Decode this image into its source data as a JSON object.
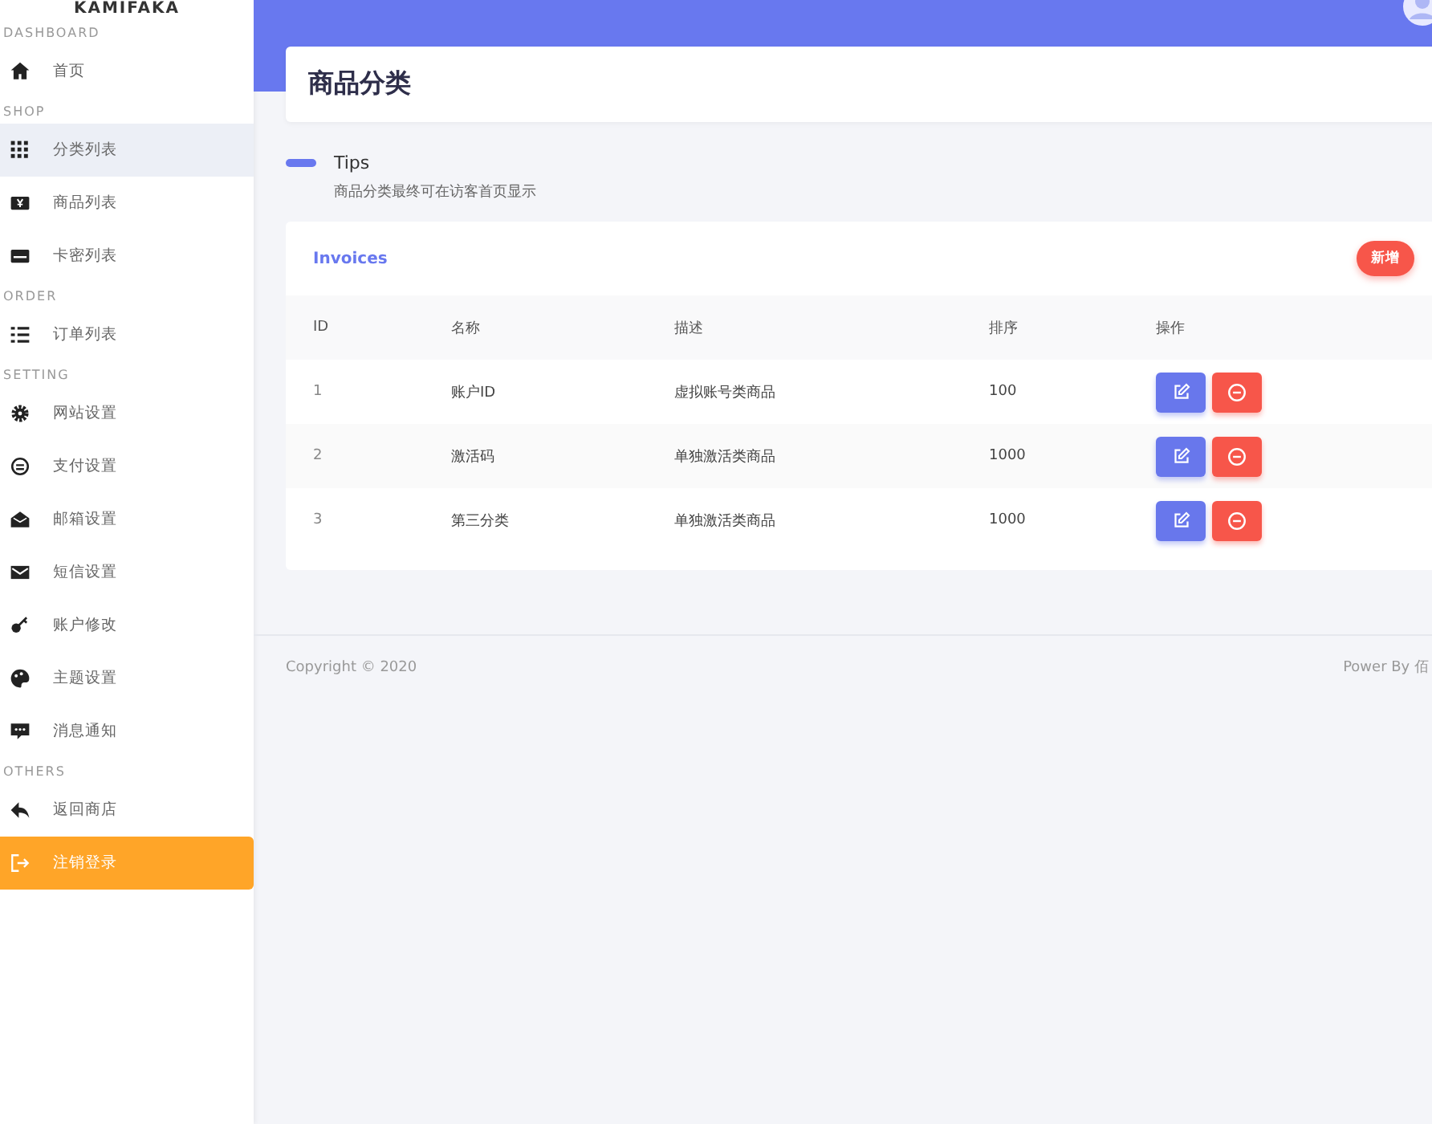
{
  "brand": "KAMIFAKA",
  "sidebar": {
    "sections": [
      {
        "title": "DASHBOARD",
        "items": [
          {
            "label": "首页",
            "selected": false,
            "hovered": false
          }
        ]
      },
      {
        "title": "SHOP",
        "items": [
          {
            "label": "分类列表",
            "selected": false,
            "hovered": true
          },
          {
            "label": "商品列表",
            "selected": false,
            "hovered": false
          },
          {
            "label": "卡密列表",
            "selected": false,
            "hovered": false
          }
        ]
      },
      {
        "title": "ORDER",
        "items": [
          {
            "label": "订单列表",
            "selected": false,
            "hovered": false
          }
        ]
      },
      {
        "title": "SETTING",
        "items": [
          {
            "label": "网站设置",
            "selected": false,
            "hovered": false
          },
          {
            "label": "支付设置",
            "selected": false,
            "hovered": false
          },
          {
            "label": "邮箱设置",
            "selected": false,
            "hovered": false
          },
          {
            "label": "短信设置",
            "selected": false,
            "hovered": false
          },
          {
            "label": "账户修改",
            "selected": false,
            "hovered": false
          },
          {
            "label": "主题设置",
            "selected": false,
            "hovered": false
          },
          {
            "label": "消息通知",
            "selected": false,
            "hovered": false
          }
        ]
      },
      {
        "title": "OTHERS",
        "items": [
          {
            "label": "返回商店",
            "selected": false,
            "hovered": false
          },
          {
            "label": "注销登录",
            "selected": true,
            "hovered": false
          }
        ]
      }
    ]
  },
  "page_title": "商品分类",
  "tips": {
    "title": "Tips",
    "text": "商品分类最终可在访客首页显示"
  },
  "table": {
    "title": "Invoices",
    "add_button": "新增",
    "columns": [
      "ID",
      "名称",
      "描述",
      "排序",
      "操作"
    ],
    "rows": [
      {
        "id": "1",
        "name": "账户ID",
        "description": "虚拟账号类商品",
        "sort": "100"
      },
      {
        "id": "2",
        "name": "激活码",
        "description": "单独激活类商品",
        "sort": "1000"
      },
      {
        "id": "3",
        "name": "第三分类",
        "description": "单独激活类商品",
        "sort": "1000"
      }
    ]
  },
  "footer": {
    "copyright": "Copyright © 2020",
    "powered": "Power By 佰"
  }
}
